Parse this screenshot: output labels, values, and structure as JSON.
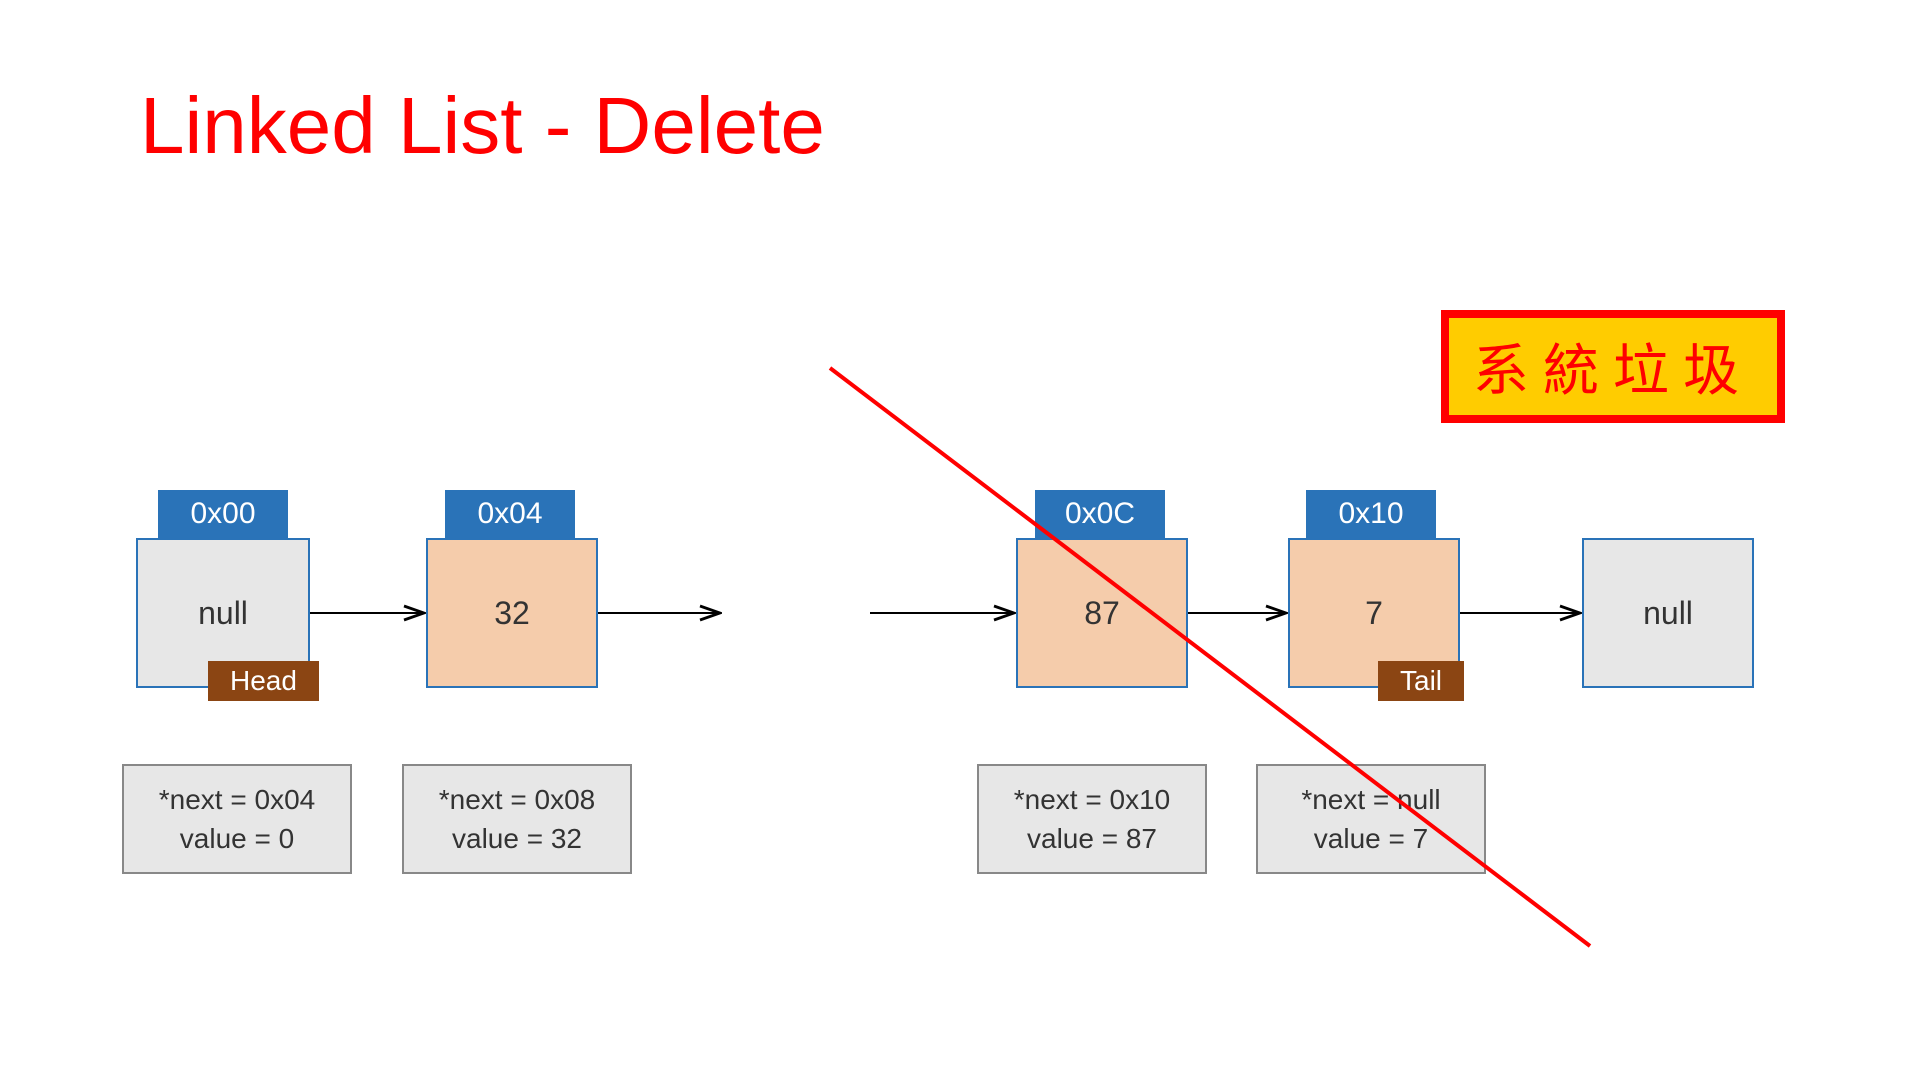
{
  "title": "Linked List - Delete",
  "garbage_label": "系統垃圾",
  "nodes": {
    "n0": {
      "addr": "0x00",
      "value": "null",
      "role": "Head",
      "info_next": "*next = 0x04",
      "info_val": "value = 0"
    },
    "n1": {
      "addr": "0x04",
      "value": "32",
      "info_next": "*next = 0x08",
      "info_val": "value = 32"
    },
    "n2": {
      "addr": "0x0C",
      "value": "87",
      "info_next": "*next = 0x10",
      "info_val": "value = 87"
    },
    "n3": {
      "addr": "0x10",
      "value": "7",
      "role": "Tail",
      "info_next": "*next = null",
      "info_val": "value = 7"
    },
    "n4": {
      "value": "null"
    }
  }
}
